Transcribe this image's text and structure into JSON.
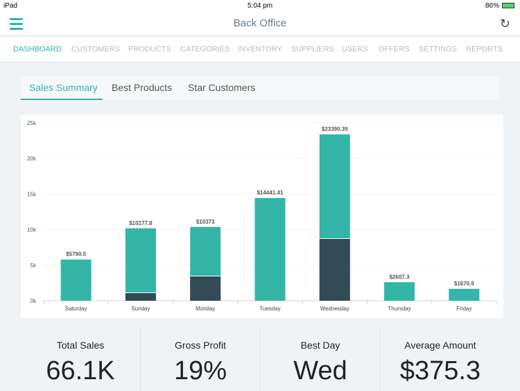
{
  "status_bar": {
    "device": "iPad",
    "time": "5:04 pm",
    "battery": "86%"
  },
  "header": {
    "title": "Back Office",
    "menu_icon": "hamburger-icon",
    "refresh_icon": "refresh-icon"
  },
  "nav": [
    "DASHBOARD",
    "CUSTOMERS",
    "PRODUCTS",
    "CATEGORIES",
    "INVENTORY",
    "SUPPLIERS",
    "USERS",
    "OFFERS",
    "SETTINGS",
    "REPORTS"
  ],
  "tabs": [
    "Sales Summary",
    "Best Products",
    "Star Customers"
  ],
  "colors": {
    "accent": "#33b5a7",
    "dark": "#324b55"
  },
  "chart_data": {
    "type": "bar",
    "stacked": true,
    "categories": [
      "Saturday",
      "Sunday",
      "Monday",
      "Tuesday",
      "Wednesday",
      "Thursday",
      "Friday"
    ],
    "totals": [
      5790.5,
      10177.8,
      10373,
      14441.41,
      23390.39,
      2607.3,
      1670.9
    ],
    "total_labels": [
      "$5790.5",
      "$10177.8",
      "$10373",
      "$14441.41",
      "$23390.39",
      "$2607.3",
      "$1670.9"
    ],
    "dark_segment": [
      0,
      1070,
      3420,
      0,
      8690,
      0,
      0
    ],
    "yticks": [
      "0k",
      "5k",
      "10k",
      "15k",
      "20k",
      "25k"
    ],
    "ylim": [
      0,
      25000
    ],
    "grid": true
  },
  "stats": [
    {
      "label": "Total Sales",
      "value": "66.1K"
    },
    {
      "label": "Gross Profit",
      "value": "19%"
    },
    {
      "label": "Best Day",
      "value": "Wed"
    },
    {
      "label": "Average Amount",
      "value": "$375.3"
    }
  ]
}
